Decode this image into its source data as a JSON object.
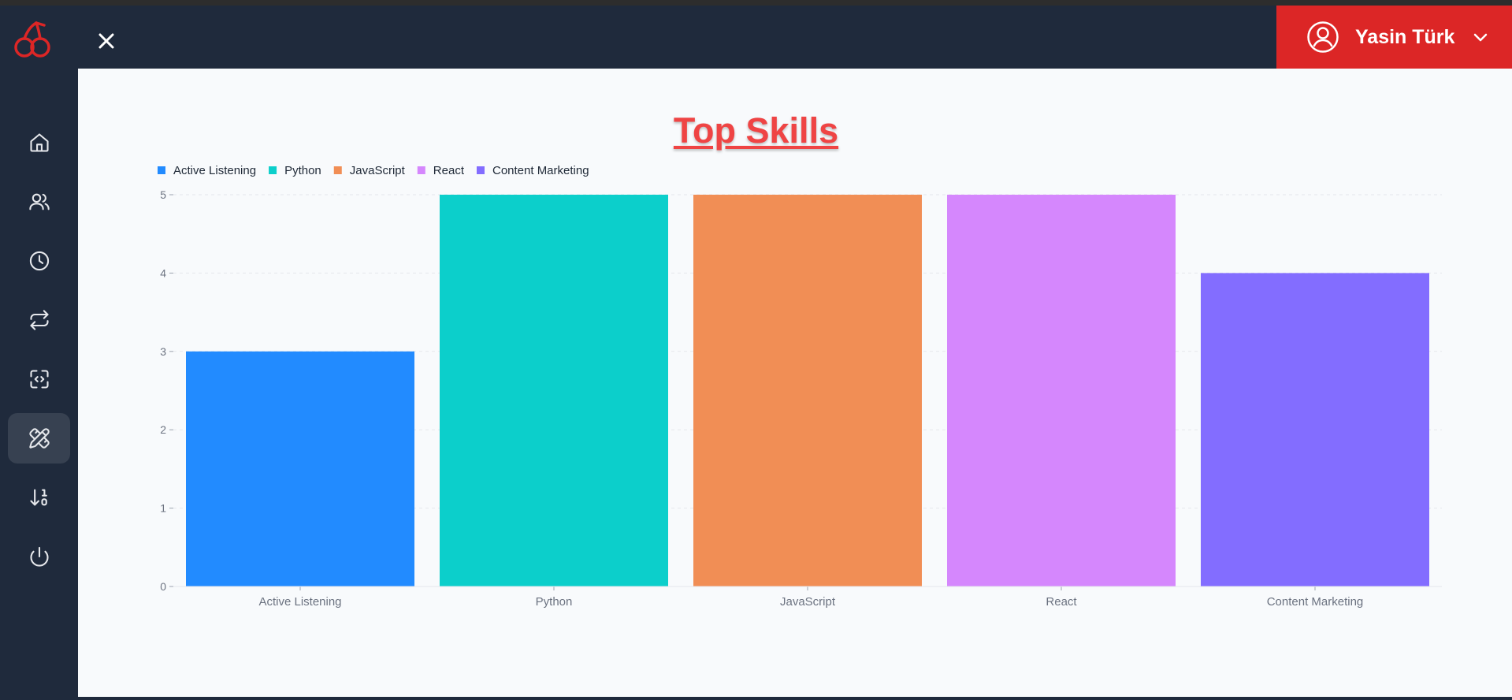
{
  "header": {
    "user_name": "Yasin Türk"
  },
  "sidebar": {
    "items": [
      {
        "icon": "home-icon"
      },
      {
        "icon": "users-icon"
      },
      {
        "icon": "clock-icon"
      },
      {
        "icon": "repeat-icon"
      },
      {
        "icon": "code-square-icon"
      },
      {
        "icon": "pencil-ruler-icon",
        "active": true
      },
      {
        "icon": "sort-numeric-icon"
      },
      {
        "icon": "power-icon"
      }
    ]
  },
  "colors": {
    "header_bg": "#1f2a3c",
    "accent_red": "#dc2626",
    "title_red": "#ef4444"
  },
  "chart_data": {
    "type": "bar",
    "title": "Top Skills",
    "categories": [
      "Active Listening",
      "Python",
      "JavaScript",
      "React",
      "Content Marketing"
    ],
    "values": [
      3,
      5,
      5,
      5,
      4
    ],
    "colors": [
      "#228bff",
      "#0ccfcb",
      "#f18e55",
      "#d587fd",
      "#836dff"
    ],
    "legend": [
      "Active Listening",
      "Python",
      "JavaScript",
      "React",
      "Content Marketing"
    ],
    "legend_position": "top-left",
    "ylim": [
      0,
      5
    ],
    "yticks": [
      0,
      1,
      2,
      3,
      4,
      5
    ],
    "grid": true,
    "xlabel": "",
    "ylabel": ""
  }
}
